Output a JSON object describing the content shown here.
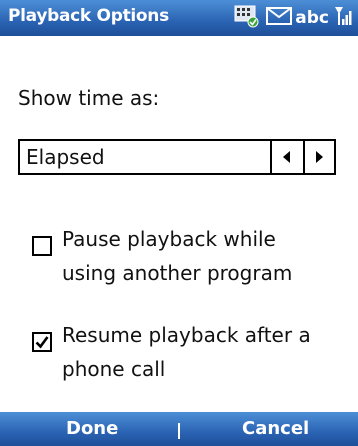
{
  "titlebar": {
    "title": "Playback Options",
    "status_icons": [
      "screen-icon",
      "message-icon",
      "signal-icon"
    ],
    "input_mode": "abc"
  },
  "main": {
    "show_time_label": "Show time as:",
    "show_time_value": "Elapsed",
    "option1": {
      "line1": "Pause playback while",
      "line2": "using another program",
      "checked": false
    },
    "option2": {
      "line1": "Resume playback after a",
      "line2": "phone call",
      "checked": true
    }
  },
  "softkeys": {
    "left": "Done",
    "right": "Cancel"
  },
  "colors": {
    "bar_top": "#4d8fd6",
    "bar_bottom": "#1f4f99",
    "text": "#111111"
  }
}
